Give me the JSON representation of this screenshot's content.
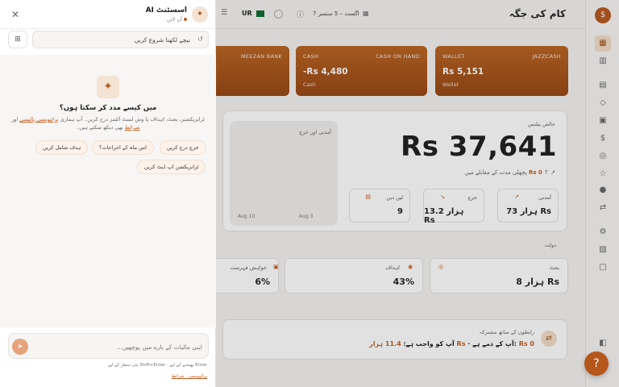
{
  "brand": "کام کی جگہ",
  "topbar": {
    "date_range": "7 اگست – 5 ستمبر",
    "currency": "UR"
  },
  "accounts": [
    {
      "bank": "MEEZAN BANK",
      "balance": "",
      "subtitle": ""
    },
    {
      "bank": "CASH",
      "bank_right": "CASH ON HAND",
      "balance": "-Rs 4,480",
      "subtitle": "Cash"
    },
    {
      "bank": "WALLET",
      "bank_right": "JAZZCASH",
      "balance": "Rs 5,151",
      "subtitle": "Wallet"
    }
  ],
  "net_worth": {
    "label": "خالص بیلنس",
    "value": "Rs 37,641",
    "change_amount": "Rs 0",
    "change_text": "پچھلی مدت کے مقابلے میں"
  },
  "income_chart": {
    "title": "آمدنی اور خرچ",
    "ticks": [
      "Aug 10",
      "Aug 3"
    ]
  },
  "stats": [
    {
      "label": "آمدنی",
      "value": "73 ہزار Rs"
    },
    {
      "label": "خرچ",
      "value": "13.2 ہزار Rs"
    },
    {
      "label": "لین دین",
      "value": "9"
    }
  ],
  "wealth": {
    "title": "دولت",
    "items": [
      {
        "label": "بجٹ",
        "value": "8 ہزار Rs"
      },
      {
        "label": "اہداف",
        "value": "43%"
      },
      {
        "label": "خواہش فہرست",
        "value": "6%"
      }
    ]
  },
  "contact": {
    "title": "رابطوں کے ساتھ مشترکہ",
    "text_prefix": "آپ کو واجب ہے:",
    "owed_to_you": "11.4 ہزار Rs",
    "text_mid": " · آپ کے ذمے ہے:",
    "owed_by_you": "Rs 0"
  },
  "assistant": {
    "title": "AI اسسٹنٹ",
    "status": "آن لائن",
    "search_text": "نیچے لکھنا شروع کریں",
    "heading": "میں کیسے مدد کر سکتا ہوں؟",
    "description_1": "ٹرانزیکشنز، بجٹ، اہداف یا وش لسٹ آئٹمز درج کریں۔ آپ ہماری",
    "privacy_link": "پرائیویسی پالیسی",
    "description_2": "اور",
    "terms_link": "شرائط",
    "description_3": "بھی دیکھ سکتے ہیں۔",
    "chips": [
      "خرچ درج کریں",
      "اس ماہ کے اخراجات؟",
      "ہدف شامل کریں",
      "ٹرانزیکشن اپ ڈیٹ کریں"
    ],
    "input_placeholder": "اپنی مالیات کے بارے میں پوچھیں...",
    "hint": "نئی سطر کے لیے Shift+Enter · بھیجنے کے لیے Enter",
    "footer_links": "پرائیویسی · شرائط"
  }
}
